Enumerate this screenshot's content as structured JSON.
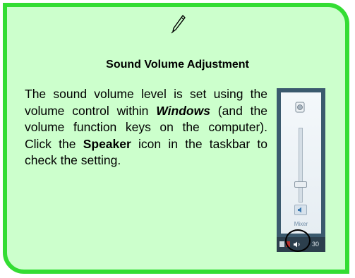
{
  "note": {
    "title": "Sound Volume Adjustment",
    "body": {
      "part1": "The sound volume level is set using the volume control within ",
      "windows": "Windows",
      "part2": " (and the volume function keys on the computer). Click the ",
      "speaker": "Speaker",
      "part3": " icon in the taskbar to check the setting."
    },
    "icon": "pen-icon"
  },
  "screenshot": {
    "mixer_label": "Mixer",
    "clock_text": "30",
    "volume_level": 0.2
  },
  "colors": {
    "box_background": "#ccffcc",
    "box_border": "#33dd33"
  }
}
